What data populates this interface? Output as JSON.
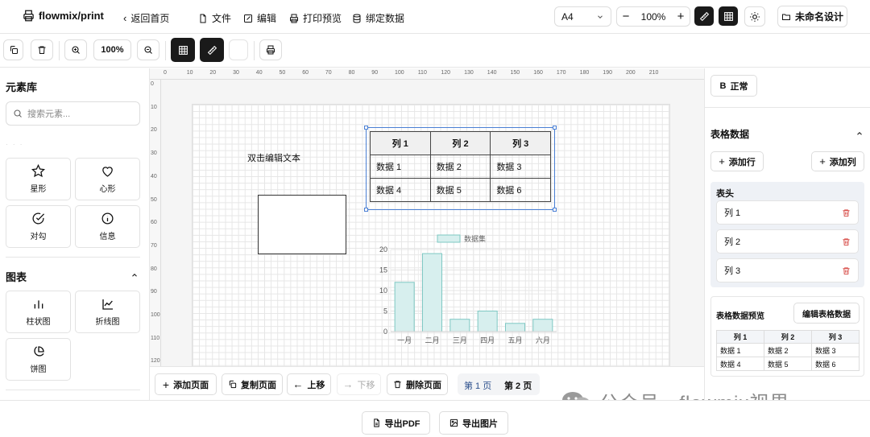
{
  "header": {
    "brand": "flowmix/print",
    "back": "返回首页",
    "menu": [
      "文件",
      "编辑",
      "打印预览",
      "绑定数据"
    ],
    "paper_size": "A4",
    "zoom": "100%",
    "design_name": "未命名设计"
  },
  "toolbar": {
    "zoom": "100%"
  },
  "left_panel": {
    "title": "元素库",
    "search_placeholder": "搜索元素...",
    "shapes": [
      {
        "label": "星形",
        "icon": "star-icon"
      },
      {
        "label": "心形",
        "icon": "heart-icon"
      },
      {
        "label": "对勾",
        "icon": "check-circle-icon"
      },
      {
        "label": "信息",
        "icon": "info-icon"
      }
    ],
    "charts_title": "图表",
    "charts": [
      {
        "label": "柱状图",
        "icon": "bar-chart-icon"
      },
      {
        "label": "折线图",
        "icon": "line-chart-icon"
      },
      {
        "label": "饼图",
        "icon": "pie-chart-icon"
      }
    ]
  },
  "ruler": {
    "top": [
      "0",
      "10",
      "20",
      "30",
      "40",
      "50",
      "60",
      "70",
      "80",
      "90",
      "100",
      "110",
      "120",
      "130",
      "140",
      "150",
      "160",
      "170",
      "180",
      "190",
      "200",
      "210"
    ],
    "left": [
      "0",
      "10",
      "20",
      "30",
      "40",
      "50",
      "60",
      "70",
      "80",
      "90",
      "100",
      "110",
      "120"
    ]
  },
  "canvas": {
    "text_element": "双击编辑文本",
    "table": {
      "headers": [
        "列 1",
        "列 2",
        "列 3"
      ],
      "rows": [
        [
          "数据 1",
          "数据 2",
          "数据 3"
        ],
        [
          "数据 4",
          "数据 5",
          "数据 6"
        ]
      ]
    }
  },
  "chart_data": {
    "type": "bar",
    "categories": [
      "一月",
      "二月",
      "三月",
      "四月",
      "五月",
      "六月"
    ],
    "series": [
      {
        "name": "数据集",
        "values": [
          12,
          19,
          3,
          5,
          2,
          3
        ]
      }
    ],
    "title": "",
    "xlabel": "",
    "ylabel": "",
    "ylim": [
      0,
      20
    ],
    "yticks": [
      0,
      5,
      10,
      15,
      20
    ],
    "legend": "top",
    "grid": true,
    "bar_color": "#d7efee",
    "bar_border": "#7ec8c3"
  },
  "page_controls": {
    "add": "添加页面",
    "copy": "复制页面",
    "up": "上移",
    "down": "下移",
    "delete": "删除页面",
    "pages": [
      "第 1 页",
      "第 2 页"
    ]
  },
  "right_panel": {
    "font_style": "正常",
    "table_data_title": "表格数据",
    "add_row": "添加行",
    "add_col": "添加列",
    "header_title": "表头",
    "headers": [
      "列 1",
      "列 2",
      "列 3"
    ],
    "preview_title": "表格数据预览",
    "edit_button": "编辑表格数据",
    "preview": {
      "headers": [
        "列 1",
        "列 2",
        "列 3"
      ],
      "rows": [
        [
          "数据 1",
          "数据 2",
          "数据 3"
        ],
        [
          "数据 4",
          "数据 5",
          "数据 6"
        ]
      ]
    }
  },
  "bottom": {
    "export_pdf": "导出PDF",
    "export_image": "导出图片"
  },
  "watermark": "公众号 · flowmix视界",
  "colors": {
    "accent": "#1a1a1a",
    "selection": "#4a7fd4",
    "delete": "#d9534f"
  }
}
